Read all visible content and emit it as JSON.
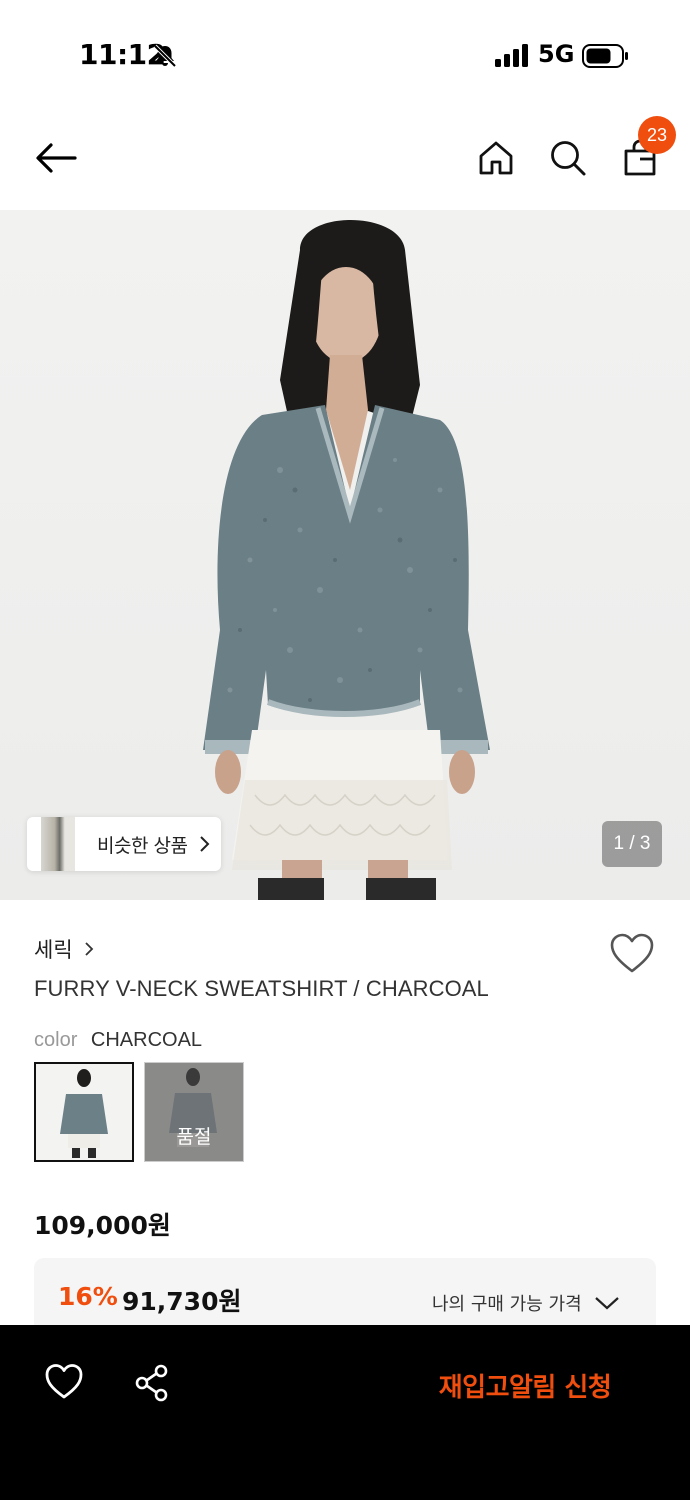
{
  "status_bar": {
    "time": "11:12",
    "network": "5G",
    "icons": [
      "bell-slash-icon",
      "signal-icon",
      "battery-icon"
    ]
  },
  "top_nav": {
    "icons": [
      "back-arrow-icon",
      "home-icon",
      "search-icon",
      "shopping-bag-icon"
    ],
    "cart_count": "23"
  },
  "gallery": {
    "similar_label": "비슷한 상품",
    "page_counter": "1 / 3"
  },
  "product": {
    "brand": "세릭",
    "title": "FURRY V-NECK SWEATSHIRT / CHARCOAL",
    "color_label": "color",
    "color_value": "CHARCOAL",
    "swatches": [
      {
        "status": ""
      },
      {
        "status": "품절"
      }
    ],
    "price_original": "109,000원",
    "discount_rate": "16%",
    "sale_price": "91,730원",
    "my_price_label": "나의 구매 가능 가격"
  },
  "bottom_bar": {
    "restock_label": "재입고알림 신청",
    "icons": [
      "heart-outline-icon",
      "share-icon"
    ]
  },
  "colors": {
    "accent": "#f04e0e",
    "bottom_bar_bg": "#000000",
    "price_box_bg": "#f5f5f5"
  }
}
